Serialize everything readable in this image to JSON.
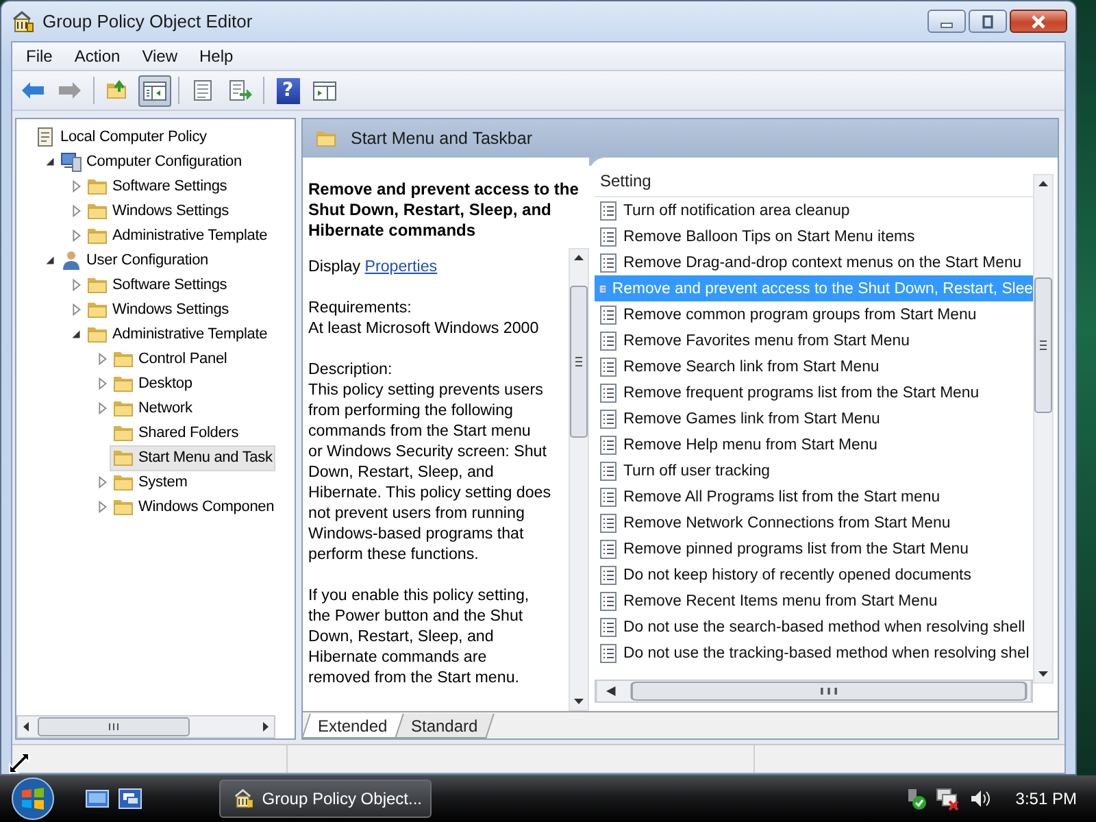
{
  "window": {
    "title": "Group Policy Object Editor"
  },
  "menu": [
    "File",
    "Action",
    "View",
    "Help"
  ],
  "toolbar": [
    {
      "kind": "back",
      "disabled": false,
      "pressed": false
    },
    {
      "kind": "forward",
      "disabled": true,
      "pressed": false
    },
    {
      "kind": "separator"
    },
    {
      "kind": "up",
      "disabled": false,
      "pressed": false
    },
    {
      "kind": "tree-toggle",
      "disabled": false,
      "pressed": true
    },
    {
      "kind": "separator"
    },
    {
      "kind": "properties",
      "disabled": false,
      "pressed": false
    },
    {
      "kind": "export",
      "disabled": false,
      "pressed": false
    },
    {
      "kind": "separator"
    },
    {
      "kind": "help",
      "glyph": "?",
      "disabled": false,
      "pressed": false
    },
    {
      "kind": "action-pane",
      "disabled": false,
      "pressed": false
    }
  ],
  "tree": [
    {
      "label": "Local Computer Policy",
      "kind": "policy",
      "selected": false,
      "children": [
        {
          "label": "Computer Configuration",
          "kind": "computer",
          "expanded": true,
          "selected": false,
          "children": [
            {
              "label": "Software Settings",
              "kind": "folder",
              "expanded": false,
              "selected": false
            },
            {
              "label": "Windows Settings",
              "kind": "folder",
              "expanded": false,
              "selected": false
            },
            {
              "label": "Administrative Template",
              "kind": "folder",
              "expanded": false,
              "selected": false
            }
          ]
        },
        {
          "label": "User Configuration",
          "kind": "user",
          "expanded": true,
          "selected": false,
          "children": [
            {
              "label": "Software Settings",
              "kind": "folder",
              "expanded": false,
              "selected": false
            },
            {
              "label": "Windows Settings",
              "kind": "folder",
              "expanded": false,
              "selected": false
            },
            {
              "label": "Administrative Template",
              "kind": "folder",
              "expanded": true,
              "selected": false,
              "children": [
                {
                  "label": "Control Panel",
                  "kind": "folder",
                  "expanded": false,
                  "selected": false
                },
                {
                  "label": "Desktop",
                  "kind": "folder",
                  "expanded": false,
                  "selected": false
                },
                {
                  "label": "Network",
                  "kind": "folder",
                  "expanded": false,
                  "selected": false
                },
                {
                  "label": "Shared Folders",
                  "kind": "folder",
                  "selected": false
                },
                {
                  "label": "Start Menu and Task",
                  "kind": "folder",
                  "selected": true
                },
                {
                  "label": "System",
                  "kind": "folder",
                  "expanded": false,
                  "selected": false
                },
                {
                  "label": "Windows Componen",
                  "kind": "folder",
                  "expanded": false,
                  "selected": false
                }
              ]
            }
          ]
        }
      ]
    }
  ],
  "detail": {
    "header": "Start Menu and Taskbar",
    "title": "Remove and prevent access to the Shut Down, Restart, Sleep, and Hibernate commands",
    "display_prefix": "Display",
    "link": "Properties",
    "requirements_label": "Requirements:",
    "requirements": "At least Microsoft Windows 2000",
    "description_label": "Description:",
    "paragraphs": [
      [
        "This policy setting prevents users",
        "from performing the following",
        "commands from the Start menu",
        "or Windows Security screen: Shut",
        "Down, Restart, Sleep, and",
        "Hibernate. This policy setting does",
        "not prevent users from running",
        "Windows-based programs that",
        "perform these functions."
      ],
      [
        "If you enable this policy setting,",
        "the Power button and the Shut",
        "Down, Restart, Sleep, and",
        "Hibernate commands are",
        "removed from the Start menu."
      ]
    ]
  },
  "settings": {
    "column": "Setting",
    "rows": [
      {
        "label": "Turn off notification area cleanup",
        "selected": false
      },
      {
        "label": "Remove Balloon Tips on Start Menu items",
        "selected": false
      },
      {
        "label": "Remove Drag-and-drop context menus on the Start Menu",
        "selected": false
      },
      {
        "label": "Remove and prevent access to the Shut Down, Restart, Slee",
        "selected": true
      },
      {
        "label": "Remove common program groups from Start Menu",
        "selected": false
      },
      {
        "label": "Remove Favorites menu from Start Menu",
        "selected": false
      },
      {
        "label": "Remove Search link from Start Menu",
        "selected": false
      },
      {
        "label": "Remove frequent programs list from the Start Menu",
        "selected": false
      },
      {
        "label": "Remove Games link from Start Menu",
        "selected": false
      },
      {
        "label": "Remove Help menu from Start Menu",
        "selected": false
      },
      {
        "label": "Turn off user tracking",
        "selected": false
      },
      {
        "label": "Remove All Programs list from the Start menu",
        "selected": false
      },
      {
        "label": "Remove Network Connections from Start Menu",
        "selected": false
      },
      {
        "label": "Remove pinned programs list from the Start Menu",
        "selected": false
      },
      {
        "label": "Do not keep history of recently opened documents",
        "selected": false
      },
      {
        "label": "Remove Recent Items menu from Start Menu",
        "selected": false
      },
      {
        "label": "Do not use the search-based method when resolving shell",
        "selected": false
      },
      {
        "label": "Do not use the tracking-based method when resolving shel",
        "selected": false
      }
    ]
  },
  "tabs": [
    {
      "label": "Extended",
      "selected": true
    },
    {
      "label": "Standard",
      "selected": false
    }
  ],
  "taskbar": {
    "task": "Group Policy Object...",
    "clock": "3:51 PM"
  }
}
